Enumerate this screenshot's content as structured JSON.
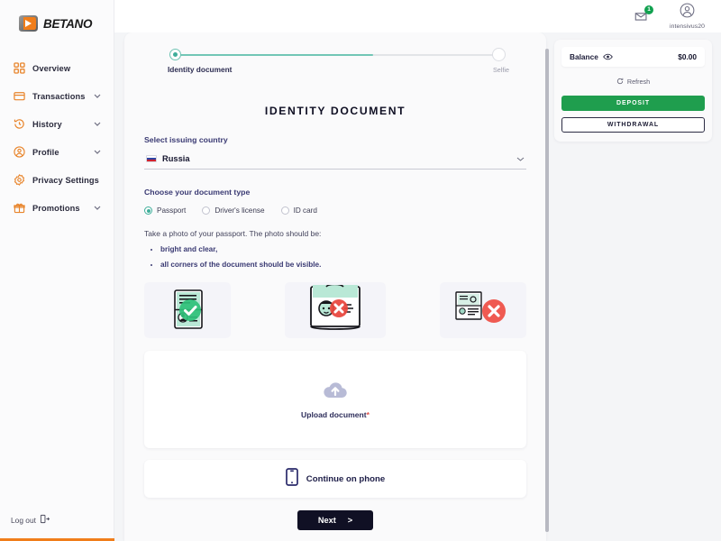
{
  "brand": {
    "name": "BETANO"
  },
  "sidebar": {
    "items": [
      {
        "label": "Overview",
        "icon": "grid-icon",
        "chevron": false
      },
      {
        "label": "Transactions",
        "icon": "card-icon",
        "chevron": true
      },
      {
        "label": "History",
        "icon": "history-icon",
        "chevron": true
      },
      {
        "label": "Profile",
        "icon": "person-icon",
        "chevron": true
      },
      {
        "label": "Privacy Settings",
        "icon": "gear-icon",
        "chevron": false
      },
      {
        "label": "Promotions",
        "icon": "gift-icon",
        "chevron": true
      }
    ],
    "logout_label": "Log out"
  },
  "topbar": {
    "messages_badge": "1",
    "username": "intensivus20"
  },
  "stepper": {
    "step_current": "Identity document",
    "step_next": "Selfie",
    "progress_percent": 61
  },
  "main": {
    "title": "IDENTITY DOCUMENT",
    "country_label": "Select issuing country",
    "country_value": "Russia",
    "doc_type_label": "Choose your document type",
    "doc_types": [
      {
        "label": "Passport",
        "selected": true
      },
      {
        "label": "Driver's license",
        "selected": false
      },
      {
        "label": "ID card",
        "selected": false
      }
    ],
    "hint": "Take a photo of your passport. The photo should be:",
    "bullets": [
      "bright and clear,",
      "all corners of the document should be visible."
    ],
    "examples": [
      {
        "name": "good-document-example",
        "status": "ok"
      },
      {
        "name": "cropped-document-example",
        "status": "bad"
      },
      {
        "name": "blurry-document-example",
        "status": "bad"
      }
    ],
    "upload_label": "Upload document",
    "upload_required_mark": "*",
    "continue_phone_label": "Continue on phone",
    "next_label": "Next",
    "next_arrow": ">"
  },
  "wallet": {
    "balance_label": "Balance",
    "balance_amount": "$0.00",
    "refresh_label": "Refresh",
    "deposit_label": "DEPOSIT",
    "withdrawal_label": "WITHDRAWAL"
  },
  "colors": {
    "brand_orange": "#f07d1a",
    "deposit_green": "#1f9e4e",
    "progress_teal": "#72c6b6",
    "dark_navy": "#101024",
    "required_red": "#e0504a"
  }
}
